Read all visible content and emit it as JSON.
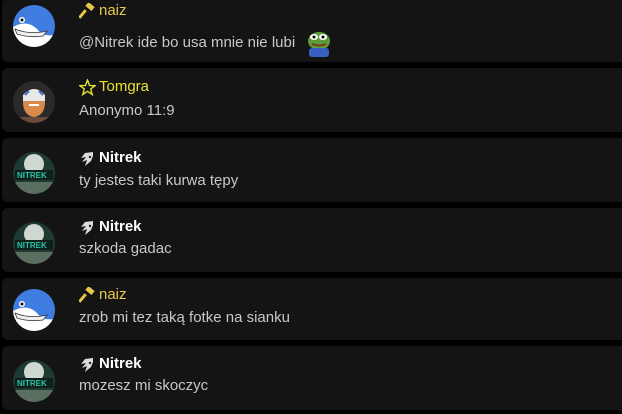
{
  "messages": [
    {
      "user": "naiz",
      "role": "hammer",
      "text": "@Nitrek ide bo usa mnie nie lubi",
      "name_color": "#e6c84a",
      "avatar": "bird",
      "emoji": "pepe-frog-emoji"
    },
    {
      "user": "Tomgra",
      "role": "star",
      "text": "Anonymo 11:9",
      "name_color": "#e8e030",
      "avatar": "warrior"
    },
    {
      "user": "Nitrek",
      "role": "sonic",
      "text": "ty jestes taki kurwa tępy",
      "name_color": "#ffffff",
      "avatar": "nitrek"
    },
    {
      "user": "Nitrek",
      "role": "sonic",
      "text": "szkoda gadac",
      "name_color": "#ffffff",
      "avatar": "nitrek"
    },
    {
      "user": "naiz",
      "role": "hammer",
      "text": "zrob mi tez taką fotke na sianku",
      "name_color": "#e6c84a",
      "avatar": "bird"
    },
    {
      "user": "Nitrek",
      "role": "sonic",
      "text": "mozesz mi skoczyc",
      "name_color": "#ffffff",
      "avatar": "nitrek"
    }
  ]
}
